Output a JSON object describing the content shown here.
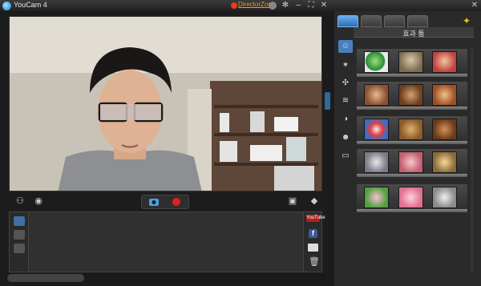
{
  "window": {
    "title": "YouCam 4",
    "director_zone": "DirectorZone",
    "title_icons": [
      "user-icon",
      "gear-icon",
      "minimize-icon",
      "fullscreen-icon",
      "close-icon"
    ]
  },
  "video": {
    "bottom_left_icons": [
      "face-tracking-icon",
      "eye-icon"
    ],
    "bottom_right_icons": [
      "screen-icon",
      "eraser-icon"
    ],
    "capture": {
      "camera": "camera-icon",
      "record": "record-icon"
    }
  },
  "library": {
    "left_buttons": [
      "view-mode-icon",
      "sort-icon",
      "filter-icon"
    ],
    "right_buttons": [
      "YouTube",
      "f",
      "email-icon",
      "trash-icon"
    ]
  },
  "effects": {
    "title": "효과 툼",
    "top_tabs": [
      "effects-tab",
      "avatar-tab",
      "magic-tab",
      "tools-tab"
    ],
    "side_tabs": [
      "scene-tab",
      "particle-tab",
      "distortion-tab",
      "filter-tab",
      "emotion-tab",
      "face-tab",
      "frame-tab"
    ],
    "rows": [
      [
        "globe-download",
        "scarecrow-doll",
        "clown-girl"
      ],
      [
        "man-avatar",
        "teddy-bear",
        "smiling-avatar"
      ],
      [
        "clown",
        "dog",
        "poodle"
      ],
      [
        "statue",
        "pig-face",
        "blonde-avatar"
      ],
      [
        "pig-mask",
        "pink-pig",
        "statue-head"
      ]
    ]
  },
  "colors": {
    "accent": "#2f6a9a",
    "active_tab": "#4a7fbf",
    "record": "#e02020",
    "youtube": "#b02020",
    "facebook": "#3b5998"
  }
}
